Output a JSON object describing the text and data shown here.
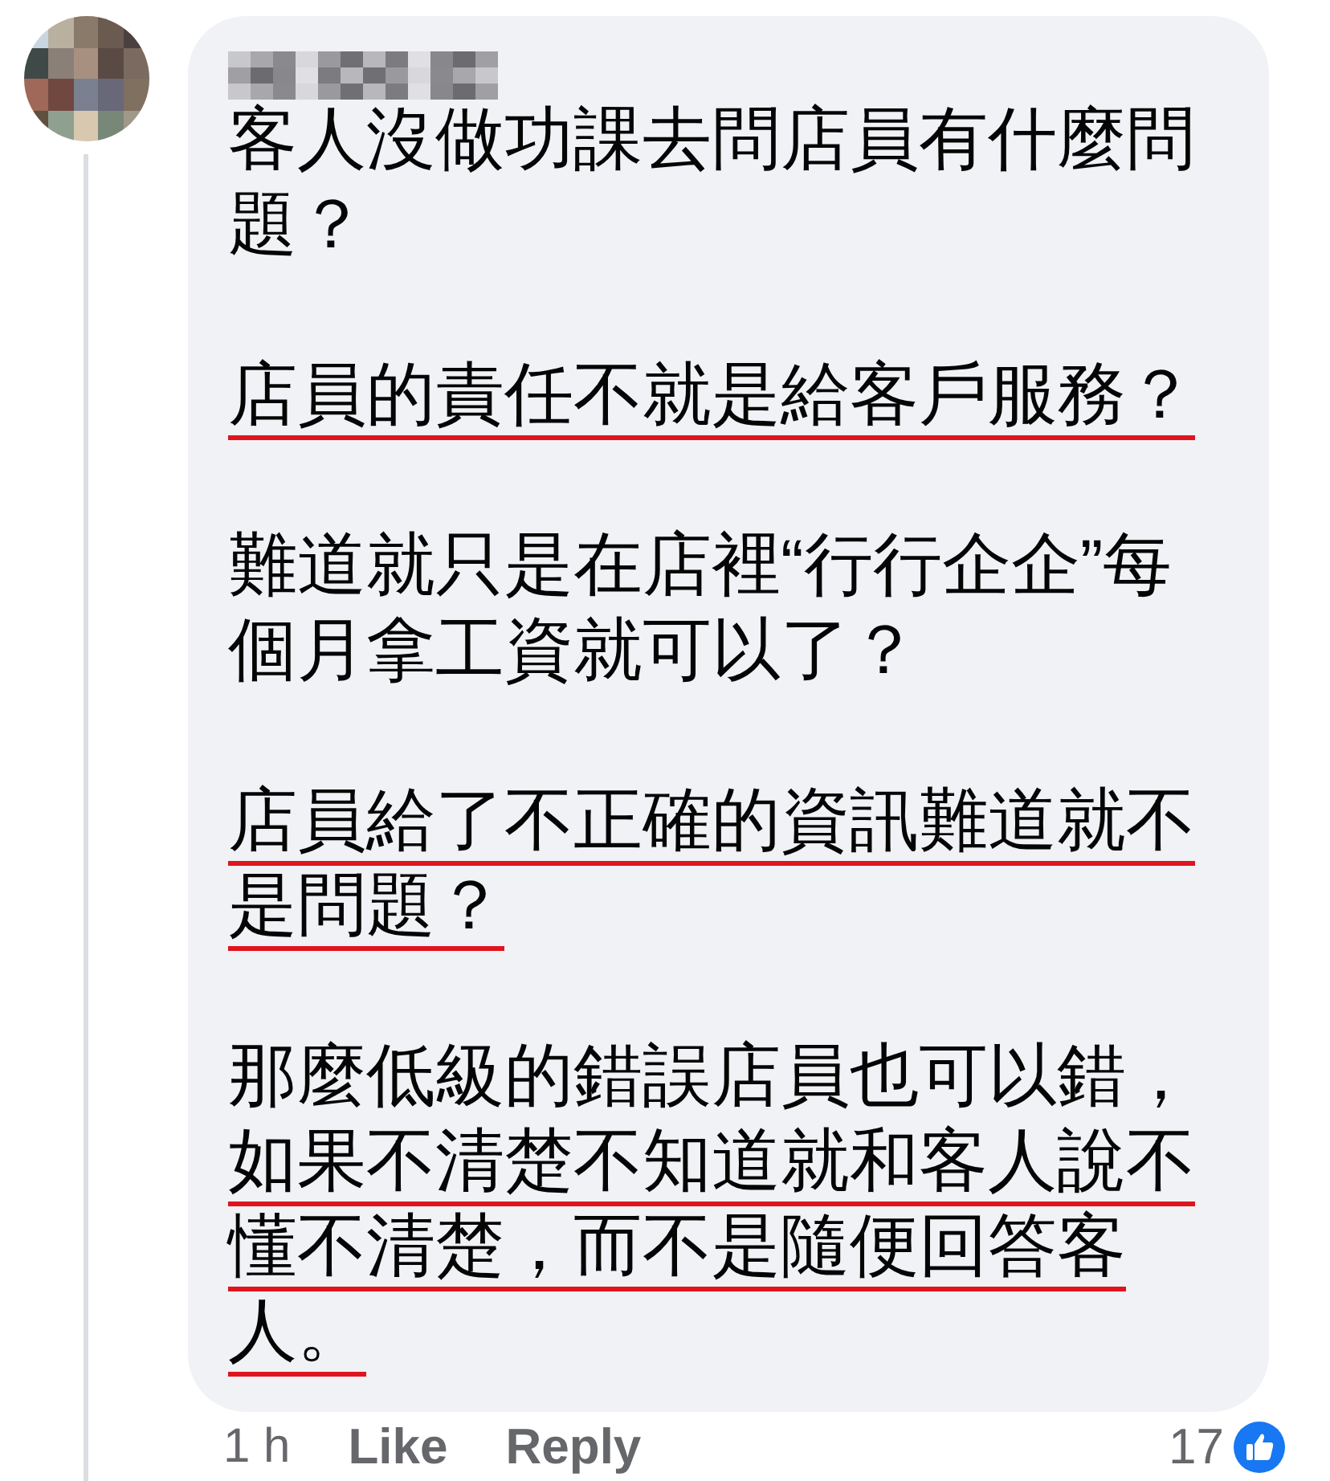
{
  "comment": {
    "paragraphs": [
      {
        "lines": [
          {
            "text": "客人沒做功課去問店員有什麼問",
            "underlined": false
          },
          {
            "text": "題？",
            "underlined": false
          }
        ]
      },
      {
        "lines": [
          {
            "text": "店員的責任不就是給客戶服務？",
            "underlined": true
          }
        ]
      },
      {
        "lines": [
          {
            "text": "難道就只是在店裡“行行企企”每",
            "underlined": false
          },
          {
            "text": "個月拿工資就可以了？",
            "underlined": false
          }
        ]
      },
      {
        "lines": [
          {
            "text": "店員給了不正確的資訊難道就不",
            "underlined": true
          },
          {
            "text": "是問題？",
            "underlined": true
          }
        ]
      },
      {
        "lines": [
          {
            "text": "那麼低級的錯誤店員也可以錯，",
            "underlined": false
          },
          {
            "text": "如果不清楚不知道就和客人說不",
            "underlined": true
          },
          {
            "text": "懂不清楚，而不是隨便回答客",
            "underlined": true
          },
          {
            "text": "人。",
            "underlined": true
          }
        ]
      }
    ],
    "time": "1 h",
    "actions": [
      "Like",
      "Reply"
    ],
    "reaction_count": "17"
  }
}
